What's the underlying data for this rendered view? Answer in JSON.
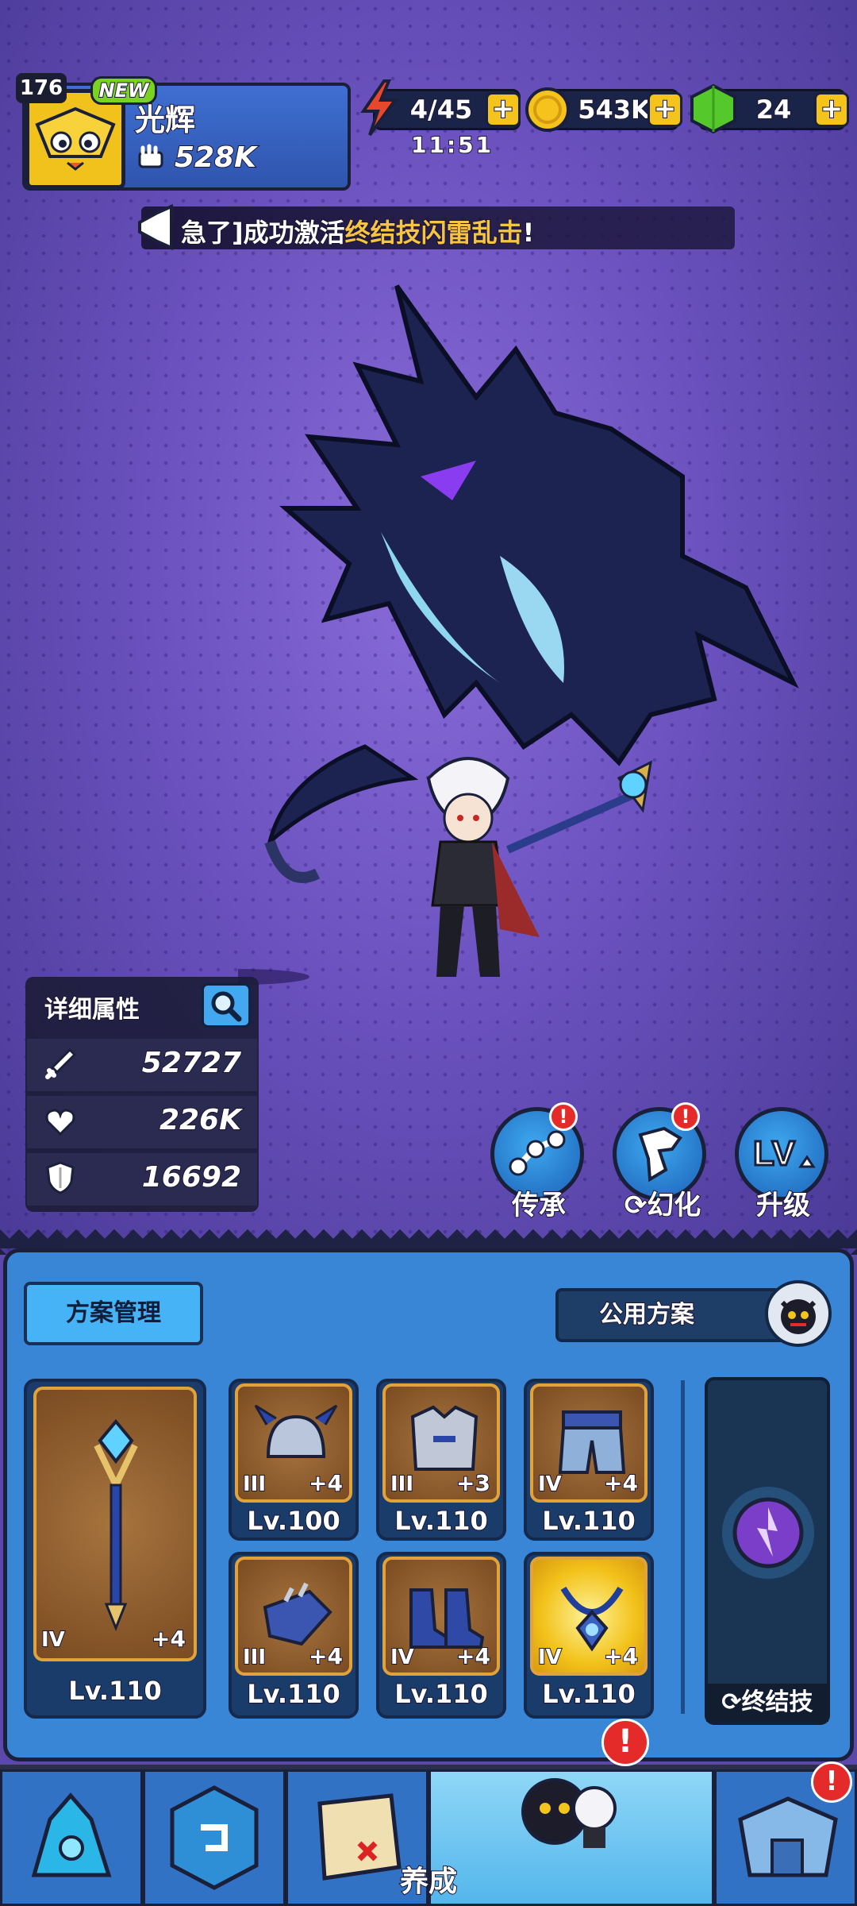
{
  "player": {
    "level": "176",
    "new_tag": "NEW",
    "name": "光辉",
    "power": "528K"
  },
  "resources": {
    "energy": "4/45",
    "energy_timer": "11:51",
    "coins": "543K",
    "gems": "24"
  },
  "notice": {
    "prefix": "急了]成功激活",
    "highlight": "终结技闪雷乱击",
    "suffix": "!"
  },
  "stats": {
    "title": "详细属性",
    "attack": "52727",
    "hp": "226K",
    "defense": "16692"
  },
  "actions": [
    {
      "label": "传承",
      "badge": "!"
    },
    {
      "label": "幻化",
      "badge": "!"
    },
    {
      "label": "升级"
    }
  ],
  "plan": {
    "manage_label": "方案管理",
    "public_label": "公用方案"
  },
  "equipment": {
    "weapon": {
      "tier": "IV",
      "plus": "+4",
      "level": "Lv.110"
    },
    "slots": [
      {
        "tier": "III",
        "plus": "+4",
        "level": "Lv.100"
      },
      {
        "tier": "III",
        "plus": "+3",
        "level": "Lv.110"
      },
      {
        "tier": "IV",
        "plus": "+4",
        "level": "Lv.110"
      },
      {
        "tier": "III",
        "plus": "+4",
        "level": "Lv.110"
      },
      {
        "tier": "IV",
        "plus": "+4",
        "level": "Lv.110"
      },
      {
        "tier": "IV",
        "plus": "+4",
        "level": "Lv.110"
      }
    ],
    "ultimate_label": "终结技"
  },
  "nav": {
    "active_label": "养成",
    "badge": "!"
  },
  "colors": {
    "accent_yellow": "#f5c41c",
    "panel_blue": "#3a86d6",
    "badge_red": "#e52a2a",
    "highlight_gold": "#f5c443"
  }
}
